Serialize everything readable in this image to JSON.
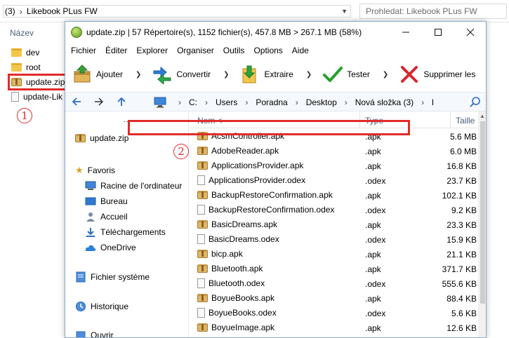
{
  "bg": {
    "crumb_prefix": "(3)",
    "crumb_current": "Likebook PLus FW",
    "search_placeholder": "Prohledat: Likebook PLus FW",
    "col_name": "Název",
    "items": [
      "dev",
      "root",
      "update.zip",
      "update-Lik"
    ]
  },
  "badges": {
    "one": "1",
    "two": "2"
  },
  "window": {
    "title": "update.zip | 57 Répertoire(s), 1152 fichier(s), 457.8 MB > 267.1 MB (58%)",
    "menu": [
      "Fichier",
      "Éditer",
      "Explorer",
      "Organiser",
      "Outils",
      "Options",
      "Aide"
    ],
    "toolbar": {
      "add": "Ajouter",
      "convert": "Convertir",
      "extract": "Extraire",
      "test": "Tester",
      "delete": "Supprimer les"
    },
    "path": [
      "C:",
      "Users",
      "Poradna",
      "Desktop",
      "Nová složka (3)",
      "l"
    ],
    "left_pane": {
      "more": "…",
      "archive": "update.zip",
      "favorites": "Favoris",
      "fav_items": [
        "Racine de l'ordinateur",
        "Bureau",
        "Accueil",
        "Téléchargements",
        "OneDrive"
      ],
      "filesystem": "Fichier système",
      "history": "Historique",
      "open": "Ouvrir"
    },
    "columns": {
      "name": "Nom <",
      "type": "Type",
      "size": "Taille"
    },
    "files": [
      {
        "name": "AcsmController.apk",
        "type": ".apk",
        "size": "5.6 MB",
        "icon": "zip"
      },
      {
        "name": "AdobeReader.apk",
        "type": ".apk",
        "size": "6.0 MB",
        "icon": "zip"
      },
      {
        "name": "ApplicationsProvider.apk",
        "type": ".apk",
        "size": "16.8 KB",
        "icon": "zip"
      },
      {
        "name": "ApplicationsProvider.odex",
        "type": ".odex",
        "size": "23.7 KB",
        "icon": "doc"
      },
      {
        "name": "BackupRestoreConfirmation.apk",
        "type": ".apk",
        "size": "102.1 KB",
        "icon": "zip"
      },
      {
        "name": "BackupRestoreConfirmation.odex",
        "type": ".odex",
        "size": "9.2 KB",
        "icon": "doc"
      },
      {
        "name": "BasicDreams.apk",
        "type": ".apk",
        "size": "23.3 KB",
        "icon": "zip"
      },
      {
        "name": "BasicDreams.odex",
        "type": ".odex",
        "size": "15.9 KB",
        "icon": "doc"
      },
      {
        "name": "bicp.apk",
        "type": ".apk",
        "size": "21.1 KB",
        "icon": "zip"
      },
      {
        "name": "Bluetooth.apk",
        "type": ".apk",
        "size": "371.7 KB",
        "icon": "zip"
      },
      {
        "name": "Bluetooth.odex",
        "type": ".odex",
        "size": "555.6 KB",
        "icon": "doc"
      },
      {
        "name": "BoyueBooks.apk",
        "type": ".apk",
        "size": "88.4 KB",
        "icon": "zip"
      },
      {
        "name": "BoyueBooks.odex",
        "type": ".odex",
        "size": "5.6 KB",
        "icon": "doc"
      },
      {
        "name": "BoyueImage.apk",
        "type": ".apk",
        "size": "12.6 KB",
        "icon": "zip"
      }
    ]
  }
}
